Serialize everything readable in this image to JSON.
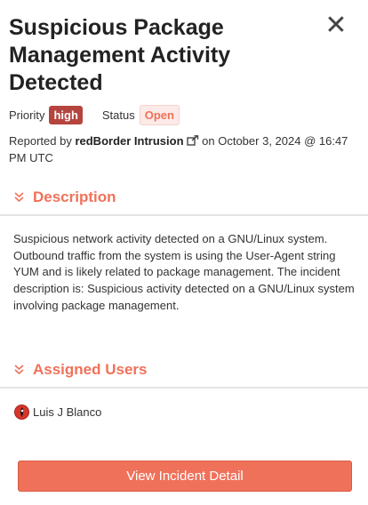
{
  "incident": {
    "title": "Suspicious Package Management Activity Detected",
    "close_symbol": "✕",
    "priority_label": "Priority",
    "priority_value": "high",
    "status_label": "Status",
    "status_value": "Open",
    "reported_prefix": "Reported by",
    "reporter": "redBorder Intrusion",
    "reported_suffix": "on October 3, 2024 @ 16:47 PM UTC"
  },
  "description": {
    "heading": "Description",
    "text": "Suspicious network activity detected on a GNU/Linux system. Outbound traffic from the system is using the User-Agent string YUM and is likely related to package management. The incident description is: Suspicious activity detected on a GNU/Linux system involving package management."
  },
  "assigned_users": {
    "heading": "Assigned Users",
    "users": [
      {
        "name": "Luis J Blanco"
      }
    ]
  },
  "actions": {
    "view_detail_label": "View Incident Detail"
  },
  "colors": {
    "accent": "#f0715a",
    "priority_high": "#b5443f",
    "status_open_bg": "#fbeae7"
  },
  "icons": [
    "close-icon",
    "external-link-icon",
    "double-chevron-down-icon",
    "avatar-icon"
  ]
}
